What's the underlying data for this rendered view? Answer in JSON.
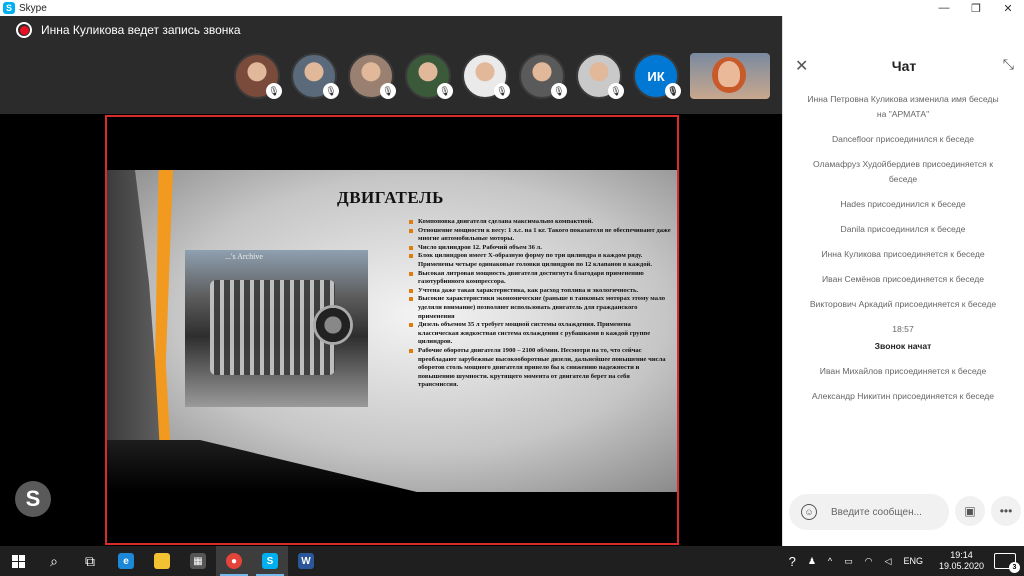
{
  "window": {
    "title": "Skype",
    "controls": {
      "minimize": "—",
      "restore": "❐",
      "close": "✕"
    }
  },
  "call": {
    "recording_text": "Инна Куликова ведет запись звонка",
    "participants": [
      {
        "kind": "photo",
        "color": "#7a4a3a"
      },
      {
        "kind": "photo",
        "color": "#5a6a7a"
      },
      {
        "kind": "photo",
        "color": "#9a8070"
      },
      {
        "kind": "photo",
        "color": "#3a5a3a"
      },
      {
        "kind": "photo",
        "color": "#eaeaea"
      },
      {
        "kind": "photo",
        "color": "#5a5a5a"
      },
      {
        "kind": "photo",
        "color": "#c9c9c9"
      },
      {
        "kind": "initials",
        "initials": "ИК"
      }
    ]
  },
  "slide": {
    "title": "ДВИГАТЕЛЬ",
    "image_caption": "...'s Archive",
    "bullets": [
      "Компоновка двигателя сделана максимально компактной.",
      "Отношение мощности к весу: 1 л.с. на 1 кг. Такого показателя не обеспечивают даже многие автомобильные моторы.",
      "Число цилиндров 12. Рабочий объем 36 л.",
      "Блок цилиндров имеет Х-образную форму по три цилиндра в каждом ряду. Применены четыре одинаковые головки цилиндров по 12 клапанов в каждой.",
      "Высокая литровая мощность двигателя достигнута благодаря применению газотурбинного компрессора.",
      "Учтена даже такая характеристика, как расход топлива и экологичность.",
      "Высокие характеристики экономические (раньше в танковых моторах этому мало уделяли внимание) позволяют использовать двигатель для гражданского применения",
      "Дизель объемом 35 л требует мощной системы охлаждения. Применена классическая жидкостная система охлаждения с рубашками в каждой группе цилиндров.",
      "Рабочие обороты двигателя 1900 – 2100 об/мин. Несмотря на то, что сейчас преобладают зарубежные высокооборотные дизели, дальнейшее повышение числа оборотов столь мощного двигателя привело бы к снижению надежности и повышению шумности. крутящего момента от двигателя берет на себя трансмиссия."
    ]
  },
  "chat": {
    "title": "Чат",
    "messages": [
      "Инна Петровна Куликова изменила имя беседы на \"АРМАТА\"",
      "Dancefloor присоединился к беседе",
      "Оламафруз Худойбердиев присоединяется к беседе",
      "Hades присоединился к беседе",
      "Danila присоединился к беседе",
      "Инна Куликова присоединяется к беседе",
      "Иван Семёнов присоединяется к беседе",
      "Викторович Аркадий присоединяется к беседе"
    ],
    "time": "18:57",
    "call_started": "Звонок начат",
    "messages_after": [
      "Иван Михайлов присоединяется к беседе",
      "Александр Никитин присоединяется к беседе"
    ],
    "input_placeholder": "Введите сообщен..."
  },
  "taskbar": {
    "lang": "ENG",
    "time": "19:14",
    "date": "19.05.2020",
    "notifications": "3"
  }
}
